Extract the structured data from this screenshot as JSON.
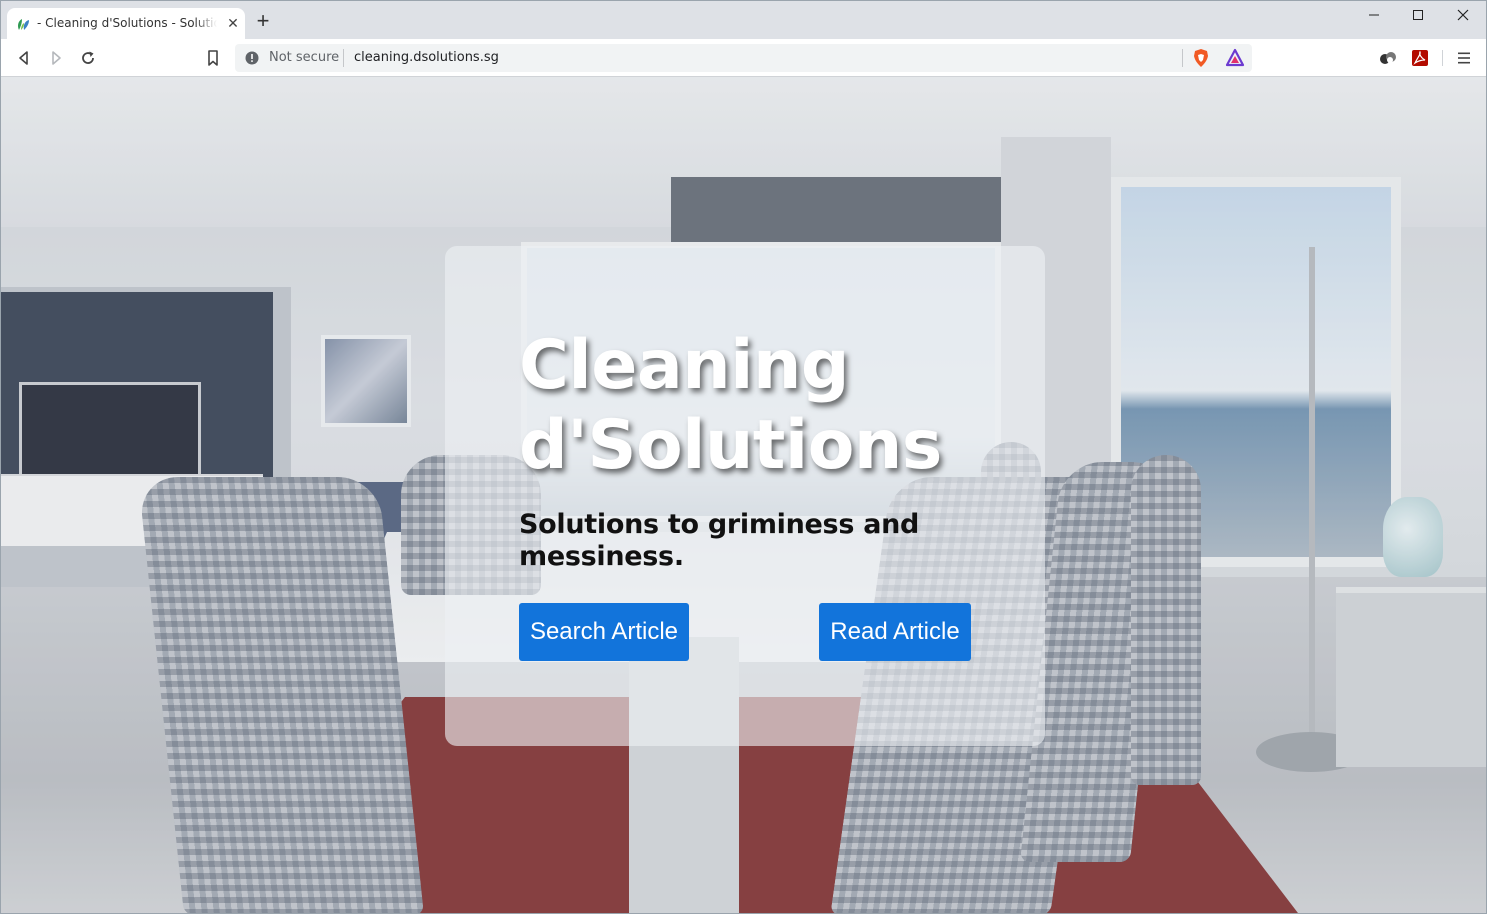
{
  "browser": {
    "tab": {
      "title": "- Cleaning d'Solutions - Solutions to griminess and messiness."
    },
    "window_controls": {
      "minimize": "—",
      "maximize": "☐",
      "close": "✕"
    },
    "new_tab": "+",
    "omnibox": {
      "security": "Not secure",
      "url": "cleaning.dsolutions.sg"
    }
  },
  "hero": {
    "title": "Cleaning d'Solutions",
    "subtitle": "Solutions to griminess and messiness.",
    "buttons": {
      "search": "Search Article",
      "read": "Read Article"
    }
  },
  "colors": {
    "button": "#1274db",
    "tabstrip": "#dee1e6",
    "card": "rgba(238,240,243,0.62)"
  }
}
